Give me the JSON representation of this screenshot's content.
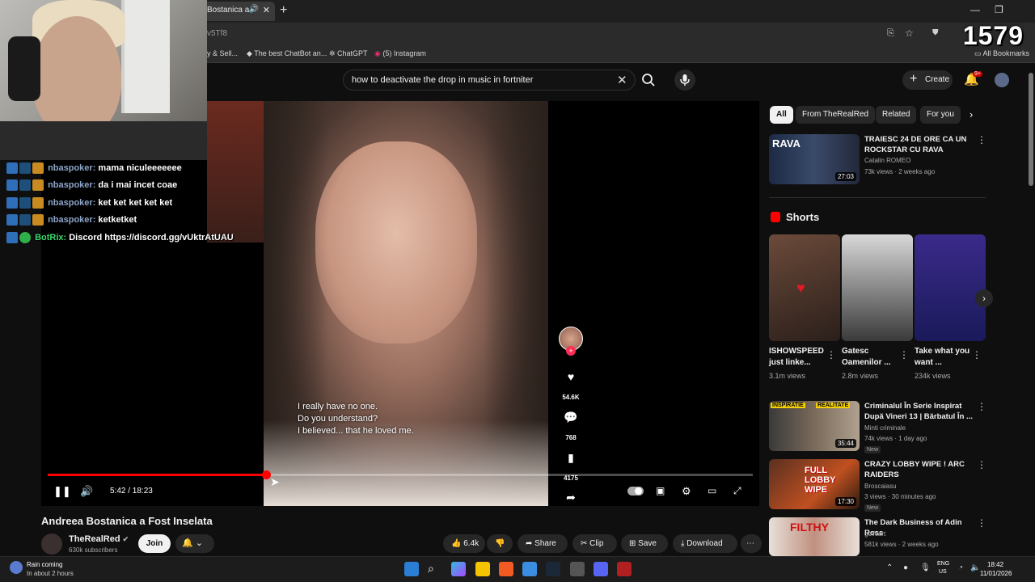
{
  "browser": {
    "tab_title": "Bostanica a F",
    "url": "v5Tf8",
    "bookmarks": [
      "y & Sell...",
      "The best ChatBot an...",
      "ChatGPT",
      "(5) Instagram"
    ],
    "all_bookmarks": "All Bookmarks"
  },
  "stream": {
    "viewer_count": "1579",
    "chat": [
      {
        "user": "nbaspoker:",
        "message": "mama niculeeeeeee"
      },
      {
        "user": "nbaspoker:",
        "message": "da i mai incet coae"
      },
      {
        "user": "nbaspoker:",
        "message": "ket ket ket ket ket"
      },
      {
        "user": "nbaspoker:",
        "message": "ketketket"
      },
      {
        "user": "BotRix:",
        "message": "Discord https://discord.gg/vUktrAtUAU"
      }
    ]
  },
  "header": {
    "search_query": "how to deactivate the drop in music in fortniter",
    "create_label": "Create",
    "notif_badge": "9+"
  },
  "player": {
    "subtitle": [
      "I really have no one.",
      "Do you understand?",
      "I believed... that he loved me."
    ],
    "likes": "54.6K",
    "comments": "768",
    "saves": "4175",
    "time": "5:42 / 18:23",
    "progress": 0.31
  },
  "video": {
    "title": "Andreea Bostanica a Fost Inselata",
    "channel": "TheRealRed",
    "subscribers": "630k subscribers",
    "join_label": "Join",
    "like_count": "6.4k",
    "share_label": "Share",
    "clip_label": "Clip",
    "save_label": "Save",
    "download_label": "Download"
  },
  "sidebar": {
    "chips": [
      "All",
      "From TheRealRed",
      "Related",
      "For you"
    ],
    "shorts_title": "Shorts",
    "recommended": [
      {
        "title": "TRAIESC 24 DE ORE CA UN ROCKSTAR CU RAVA",
        "channel": "Catalin ROMEO",
        "meta": "73k views · 2 weeks ago",
        "duration": "27:03",
        "new": ""
      },
      {
        "title": "Criminalul În Serie Inspirat După Vineri 13 | Bărbatul În ...",
        "channel": "Minti criminale",
        "meta": "74k views · 1 day ago",
        "duration": "35:44",
        "new": "New"
      },
      {
        "title": "CRAZY LOBBY WIPE ! ARC RAIDERS",
        "channel": "Broscaiasu",
        "meta": "3 views · 30 minutes ago",
        "duration": "17:30",
        "new": "New"
      },
      {
        "title": "The Dark Business of Adin Ross",
        "channel": "golfcart",
        "meta": "581k views · 2 weeks ago",
        "duration": "",
        "new": ""
      }
    ],
    "thumb_labels": {
      "rava": "RAVA",
      "insp1": "INSPIRATIE",
      "insp2": "REALITATE",
      "wipe": "FULL LOBBY WIPE",
      "filthy": "FILTHY"
    },
    "shorts": [
      {
        "title": "ISHOWSPEED just linke...",
        "views": "3.1m views"
      },
      {
        "title": "Gatesc Oamenilor ...",
        "views": "2.8m views"
      },
      {
        "title": "Take what you want ...",
        "views": "234k views"
      }
    ]
  },
  "taskbar": {
    "weather_title": "Rain coming",
    "weather_sub": "In about 2 hours",
    "lang1": "ENG",
    "lang2": "US",
    "time": "18:42",
    "date": "11/01/2026"
  },
  "colors": {
    "accent": "#ff0000",
    "bg": "#0f0f0f",
    "chip": "#272727"
  }
}
